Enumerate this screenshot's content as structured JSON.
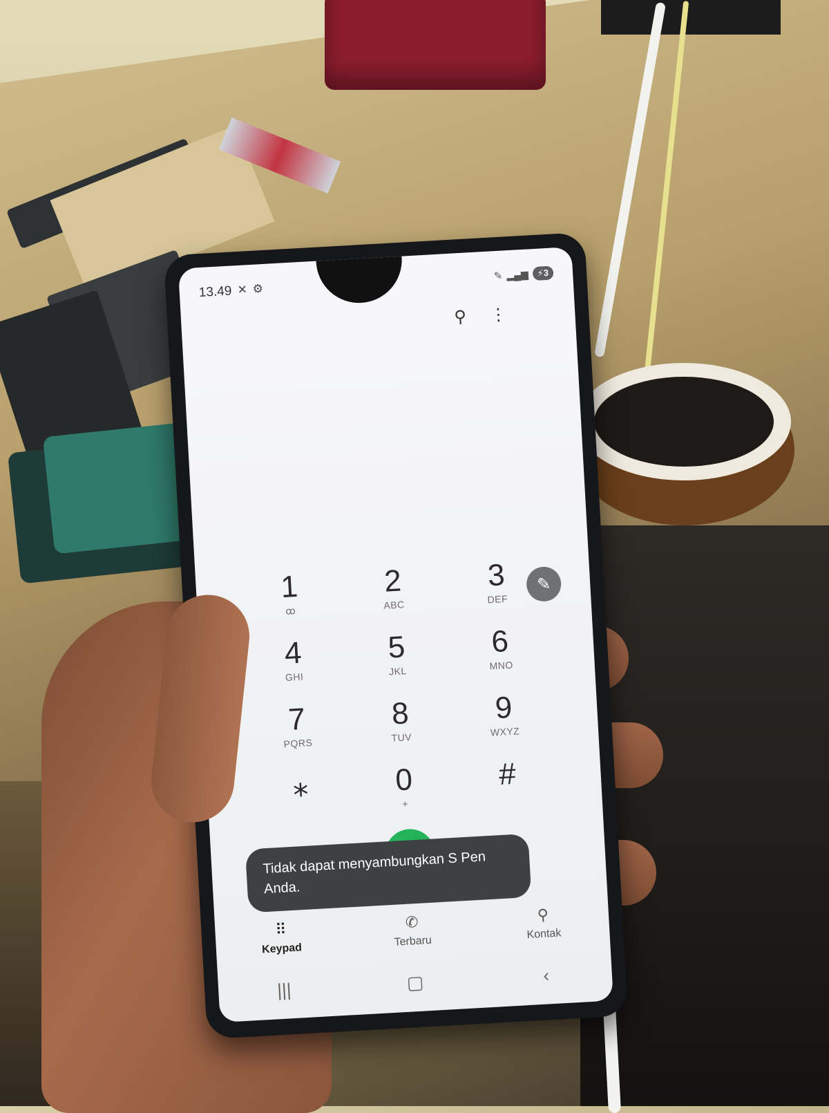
{
  "status_bar": {
    "time": "13.49",
    "icons": [
      "mute-icon",
      "settings-gear-icon",
      "pen-icon",
      "signal-icon",
      "battery-icon"
    ],
    "battery": "3"
  },
  "dialer": {
    "toolbar_icons": [
      "search-icon",
      "more-options-icon"
    ],
    "keys": [
      {
        "digit": "1",
        "letters": "ꝏ"
      },
      {
        "digit": "2",
        "letters": "ABC"
      },
      {
        "digit": "3",
        "letters": "DEF"
      },
      {
        "digit": "4",
        "letters": "GHI"
      },
      {
        "digit": "5",
        "letters": "JKL"
      },
      {
        "digit": "6",
        "letters": "MNO"
      },
      {
        "digit": "7",
        "letters": "PQRS"
      },
      {
        "digit": "8",
        "letters": "TUV"
      },
      {
        "digit": "9",
        "letters": "WXYZ"
      },
      {
        "digit": "⁎",
        "letters": ""
      },
      {
        "digit": "0",
        "letters": "+"
      },
      {
        "digit": "#",
        "letters": ""
      }
    ],
    "toast": "Tidak dapat menyambungkan S Pen Anda.",
    "colors": {
      "call_button": "#25b35a",
      "toast_bg": "#3e4144"
    }
  },
  "bottom_nav": {
    "items": [
      {
        "label": "Keypad",
        "icon": "keypad-grid-icon",
        "active": true
      },
      {
        "label": "Terbaru",
        "icon": "recent-calls-icon",
        "active": false
      },
      {
        "label": "Kontak",
        "icon": "contact-person-icon",
        "active": false
      }
    ]
  },
  "system_nav": [
    "recent-apps-icon",
    "home-icon",
    "back-icon"
  ]
}
